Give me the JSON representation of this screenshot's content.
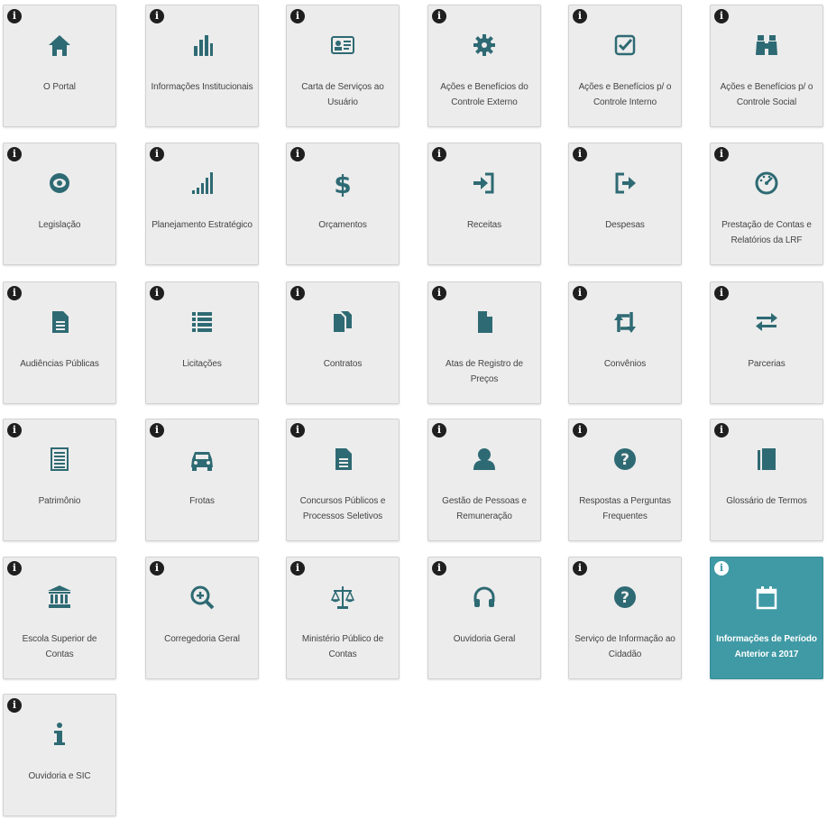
{
  "colors": {
    "tile_bg": "#ececec",
    "active_bg": "#3f9aa5",
    "icon": "#2e6a73",
    "label": "#444444"
  },
  "info_glyph": "i",
  "tiles": [
    {
      "label": "O Portal",
      "icon": "home-icon"
    },
    {
      "label": "Informações Institucionais",
      "icon": "bar-chart-icon"
    },
    {
      "label": "Carta de Serviços ao Usuário",
      "icon": "id-card-icon"
    },
    {
      "label": "Ações e Benefícios do Controle Externo",
      "icon": "gear-icon"
    },
    {
      "label": "Ações e Benefícios p/ o Controle Interno",
      "icon": "checkbox-icon"
    },
    {
      "label": "Ações e Benefícios p/ o Controle Social",
      "icon": "binoculars-icon"
    },
    {
      "label": "Legislação",
      "icon": "eye-icon"
    },
    {
      "label": "Planejamento Estratégico",
      "icon": "signal-icon"
    },
    {
      "label": "Orçamentos",
      "icon": "dollar-icon"
    },
    {
      "label": "Receitas",
      "icon": "sign-in-icon"
    },
    {
      "label": "Despesas",
      "icon": "sign-out-icon"
    },
    {
      "label": "Prestação de Contas e Relatórios da LRF",
      "icon": "dashboard-icon"
    },
    {
      "label": "Audiências Públicas",
      "icon": "document-icon"
    },
    {
      "label": "Licitações",
      "icon": "list-icon"
    },
    {
      "label": "Contratos",
      "icon": "files-icon"
    },
    {
      "label": "Atas de Registro de Preços",
      "icon": "file-icon"
    },
    {
      "label": "Convênios",
      "icon": "retweet-icon"
    },
    {
      "label": "Parcerias",
      "icon": "exchange-icon"
    },
    {
      "label": "Patrimônio",
      "icon": "ledger-icon"
    },
    {
      "label": "Frotas",
      "icon": "car-icon"
    },
    {
      "label": "Concursos Públicos e Processos Seletivos",
      "icon": "document-icon"
    },
    {
      "label": "Gestão de Pessoas e Remuneração",
      "icon": "user-icon"
    },
    {
      "label": "Respostas a Perguntas Frequentes",
      "icon": "question-icon"
    },
    {
      "label": "Glossário de Termos",
      "icon": "book-icon"
    },
    {
      "label": "Escola Superior de Contas",
      "icon": "bank-icon"
    },
    {
      "label": "Corregedoria Geral",
      "icon": "zoom-in-icon"
    },
    {
      "label": "Ministério Público de Contas",
      "icon": "balance-scale-icon"
    },
    {
      "label": "Ouvidoria Geral",
      "icon": "headphones-icon"
    },
    {
      "label": "Serviço de Informação ao Cidadão",
      "icon": "question-icon"
    },
    {
      "label": "Informações de Período Anterior a 2017",
      "icon": "calendar-icon",
      "active": true
    },
    {
      "label": "Ouvidoria e SIC",
      "icon": "info-letter-icon"
    }
  ]
}
